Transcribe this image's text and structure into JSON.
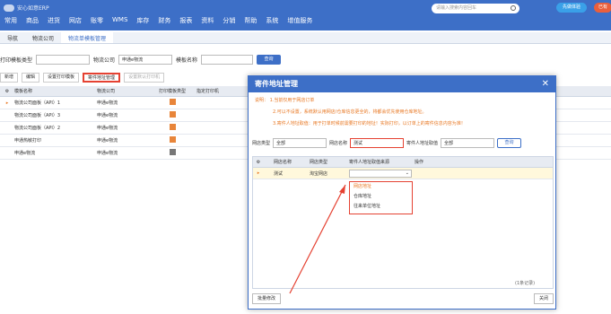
{
  "header": {
    "logo_text": "安心如意ERP",
    "search_placeholder": "请输入搜索内容回车",
    "upgrade": "先做体验",
    "account": "已有"
  },
  "nav": [
    "常用",
    "商品",
    "进货",
    "网店",
    "账零",
    "WMS",
    "库存",
    "财务",
    "报表",
    "资料",
    "分销",
    "帮助",
    "系统",
    "增值服务"
  ],
  "tabs": [
    "导航",
    "物流公司",
    "物流单模板管理"
  ],
  "filters": {
    "label1": "打印模板类型",
    "label2": "物流公司",
    "value2": "申通e物流",
    "label3": "模板名称",
    "query": "查询"
  },
  "toolbar": [
    "新增",
    "编辑",
    "设置打印模板",
    "寄件地址管理",
    "设置默认打印机"
  ],
  "grid": {
    "headers": [
      "模板名称",
      "物流公司",
      "打印模板类型",
      "指定打印机"
    ],
    "rows": [
      {
        "name": "物流公司面板（API）1",
        "co": "申通e物流"
      },
      {
        "name": "物流公司面板（API）3",
        "co": "申通e物流"
      },
      {
        "name": "物流公司面板（API）2",
        "co": "申通e物流"
      },
      {
        "name": "申通热敏打印",
        "co": "申通e物流"
      },
      {
        "name": "申通e物流",
        "co": "申通e物流"
      }
    ]
  },
  "dialog": {
    "title": "寄件地址管理",
    "note_label": "说明：",
    "notes": [
      "1.当前仅用于网店订单",
      "2.可以不设置，系统默认用网店/仓库信息更全的，将都会优先使用仓库地址。",
      "3.寄件人地址取值：用于打单时候前需要打印的地址！实际打印，以订单上的寄件信息内容为准！"
    ],
    "f1_label": "网店类型",
    "f1_value": "全部",
    "f2_label": "网店名称",
    "f2_value": "测试",
    "f3_label": "寄件人地址取值",
    "f3_value": "全部",
    "query": "查询",
    "headers": [
      "网店名称",
      "网店类型",
      "寄件人地址取值来源",
      "操作"
    ],
    "row": {
      "name": "测试",
      "type": "淘宝网店"
    },
    "options": [
      "网店地址",
      "仓库地址",
      "往来单位地址"
    ],
    "count": "(1条记录)",
    "batch": "批量修改",
    "close": "关闭"
  }
}
